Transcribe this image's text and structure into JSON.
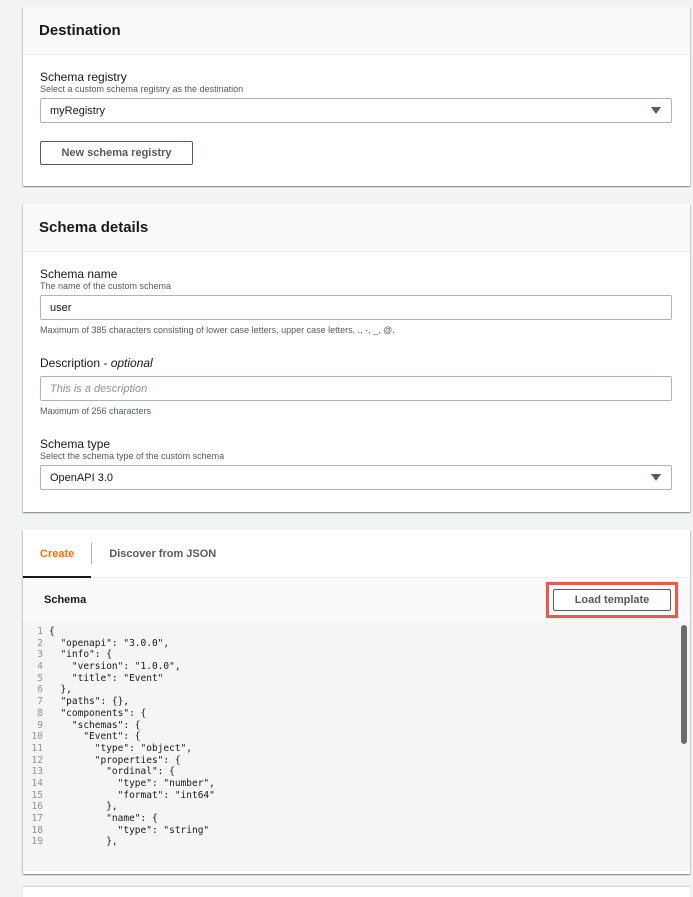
{
  "destination": {
    "title": "Destination",
    "registry_label": "Schema registry",
    "registry_desc": "Select a custom schema registry as the destination",
    "registry_value": "myRegistry",
    "new_registry_button": "New schema registry"
  },
  "details": {
    "title": "Schema details",
    "name_label": "Schema name",
    "name_desc": "The name of the custom schema",
    "name_value": "user",
    "name_constraint": "Maximum of 385 characters consisting of lower case letters, upper case letters, ., -, _, @.",
    "desc_label": "Description - ",
    "desc_optional": "optional",
    "desc_placeholder": "This is a description",
    "desc_constraint": "Maximum of 256 characters",
    "type_label": "Schema type",
    "type_desc": "Select the schema type of the custom schema",
    "type_value": "OpenAPI 3.0"
  },
  "editor_panel": {
    "tabs": [
      {
        "label": "Create"
      },
      {
        "label": "Discover from JSON"
      }
    ],
    "schema_title": "Schema",
    "load_template_button": "Load template",
    "code_lines": [
      "{",
      "  \"openapi\": \"3.0.0\",",
      "  \"info\": {",
      "    \"version\": \"1.0.0\",",
      "    \"title\": \"Event\"",
      "  },",
      "  \"paths\": {},",
      "  \"components\": {",
      "    \"schemas\": {",
      "      \"Event\": {",
      "        \"type\": \"object\",",
      "        \"properties\": {",
      "          \"ordinal\": {",
      "            \"type\": \"number\",",
      "            \"format\": \"int64\"",
      "          },",
      "          \"name\": {",
      "            \"type\": \"string\"",
      "          },"
    ]
  },
  "colors": {
    "accent": "#ec7211",
    "highlight": "#e25c4f"
  }
}
